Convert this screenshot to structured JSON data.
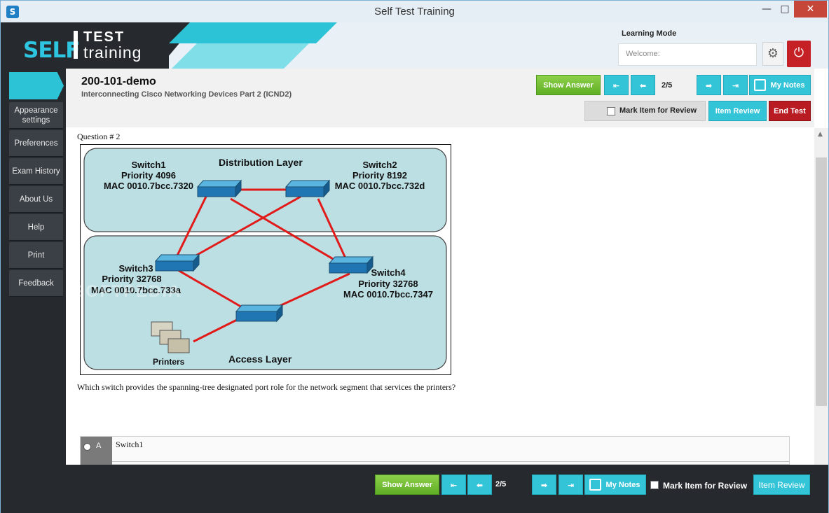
{
  "window": {
    "title": "Self Test Training"
  },
  "header": {
    "logo_self": "SELF",
    "logo_test": "TEST",
    "logo_training": "training",
    "mode_label": "Learning Mode",
    "welcome_placeholder": "Welcome:"
  },
  "sidebar": {
    "items": [
      {
        "label": "Appearance settings"
      },
      {
        "label": "Preferences"
      },
      {
        "label": "Exam History"
      },
      {
        "label": "About Us"
      },
      {
        "label": "Help"
      },
      {
        "label": "Print"
      },
      {
        "label": "Feedback"
      }
    ]
  },
  "exam": {
    "title": "200-101-demo",
    "subtitle": "Interconnecting Cisco Networking Devices Part 2 (ICND2)"
  },
  "toolbar": {
    "show_answer": "Show Answer",
    "counter": "2/5",
    "my_notes": "My Notes",
    "mark_review": "Mark Item for Review",
    "item_review": "Item Review",
    "end_test": "End Test"
  },
  "question": {
    "label": "Question # 2",
    "text": "Which switch provides the spanning-tree designated port role for the network segment that services the printers?",
    "watermark": "SOFTPEDIA",
    "diagram": {
      "distribution_label": "Distribution Layer",
      "access_label": "Access Layer",
      "printers_label": "Printers",
      "switch1": {
        "name": "Switch1",
        "priority": "Priority 4096",
        "mac": "MAC 0010.7bcc.7320"
      },
      "switch2": {
        "name": "Switch2",
        "priority": "Priority 8192",
        "mac": "MAC 0010.7bcc.732d"
      },
      "switch3": {
        "name": "Switch3",
        "priority": "Priority 32768",
        "mac": "MAC 0010.7bcc.733a"
      },
      "switch4": {
        "name": "Switch4",
        "priority": "Priority 32768",
        "mac": "MAC 0010.7bcc.7347"
      }
    },
    "options": [
      {
        "letter": "A",
        "text": "Switch1"
      }
    ]
  },
  "footer": {
    "show_answer": "Show Answer",
    "counter": "2/5",
    "my_notes": "My Notes",
    "mark_review": "Mark Item for Review",
    "item_review": "Item Review"
  }
}
